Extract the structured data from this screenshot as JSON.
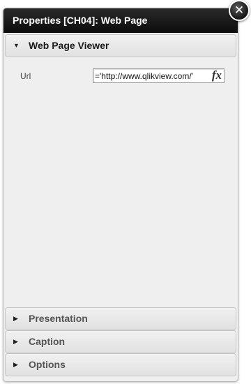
{
  "window": {
    "title": "Properties [CH04]: Web Page",
    "close_icon": "close-icon"
  },
  "sections": {
    "web_page_viewer": {
      "label": "Web Page Viewer",
      "state": "expanded"
    },
    "presentation": {
      "label": "Presentation",
      "state": "collapsed"
    },
    "caption": {
      "label": "Caption",
      "state": "collapsed"
    },
    "options": {
      "label": "Options",
      "state": "collapsed"
    }
  },
  "url_property": {
    "label": "Url",
    "value": "='http://www.qlikview.com/'",
    "fx_label": "fx"
  }
}
